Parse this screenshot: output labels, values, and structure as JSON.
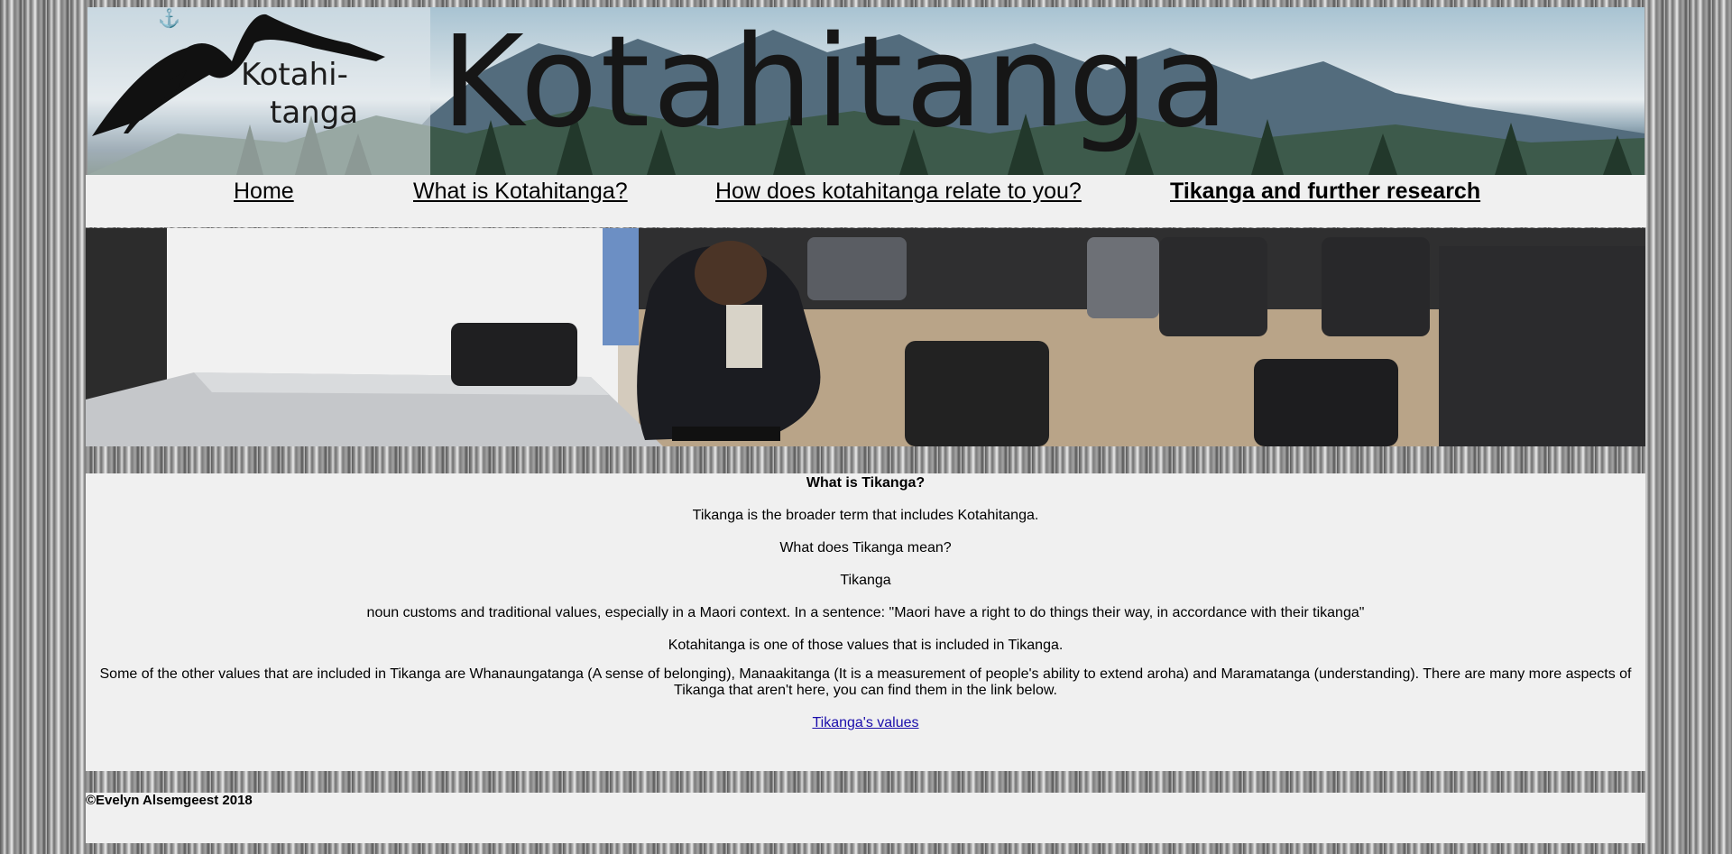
{
  "banner": {
    "logo_line1": "Kotahi-",
    "logo_line2": "tanga",
    "title": "Kotahitanga",
    "anchor_icon": "anchor-icon"
  },
  "nav": {
    "items": [
      {
        "label": "Home",
        "active": false
      },
      {
        "label": "What is Kotahitanga?",
        "active": false
      },
      {
        "label": "How does kotahitanga relate to you?",
        "active": false
      },
      {
        "label": "Tikanga and further research",
        "active": true
      }
    ]
  },
  "content": {
    "heading": "What is Tikanga?",
    "p1": "Tikanga is the broader term that includes Kotahitanga.",
    "p2": "What does Tikanga mean?",
    "p3": "Tikanga",
    "p4": "noun customs and traditional values, especially in a Maori context. In a sentence: \"Maori have a right to do things their way, in accordance with their tikanga\"",
    "p5": "Kotahitanga is one of those values that is included in Tikanga.",
    "p6": "Some of the other values that are included in Tikanga are Whanaungatanga (A sense of belonging), Manaakitanga (It is a measurement of people's ability to extend aroha) and Maramatanga (understanding). There are many more aspects of Tikanga that aren't here, you can find them in the link below.",
    "link": "Tikanga's values "
  },
  "footer": {
    "copyright": "©Evelyn Alsemgeest 2018"
  },
  "colors": {
    "panel": "#f0f0f0",
    "link": "#1a0dab"
  }
}
